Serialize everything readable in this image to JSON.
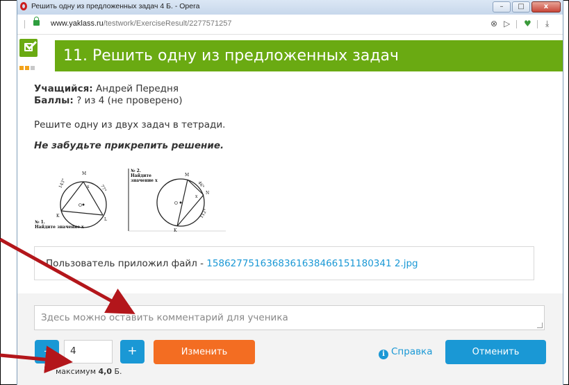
{
  "window": {
    "title": "Решить одну из предложенных задач 4 Б. - Opera",
    "minimize": "–",
    "maximize": "□",
    "close": "x"
  },
  "address": {
    "domain": "www.yaklass.ru",
    "path": "/testwork/ExerciseResult/2277571257"
  },
  "page": {
    "title": "11. Решить одну из предложенных задач",
    "student_label": "Учащийся:",
    "student_name": "Андрей Передня",
    "score_label": "Баллы:",
    "score_value": "? из 4 (не проверено)",
    "task_text": "Решите одну из двух задач в тетради.",
    "task_note": "Не забудьте прикрепить решение."
  },
  "figure": {
    "p1_head1": "№ 1.",
    "p1_head2": "Найдите значение x",
    "p1_m": "M",
    "p1_k": "K",
    "p1_l": "L",
    "p1_x": "x",
    "p1_o": "O",
    "p1_a1": "143°",
    "p1_a2": "77°",
    "p2_head1": "№ 2.",
    "p2_head2": "Найдите",
    "p2_head3": "значение x",
    "p2_m": "M",
    "p2_n": "N",
    "p2_k": "K",
    "p2_x": "x",
    "p2_o": "O",
    "p2_a1": "46°",
    "p2_a2": "112°"
  },
  "attachment": {
    "prefix": "Пользователь приложил файл - ",
    "filename": "1586277516368361638466151180341 2.jpg"
  },
  "grading": {
    "comment_placeholder": "Здесь можно оставить комментарий для ученика",
    "minus": "–",
    "plus": "+",
    "score": "4",
    "max_prefix": "максимум",
    "max_value": "4,0",
    "max_suffix": "Б.",
    "change_button": "Изменить",
    "help": "Справка",
    "help_icon": "i",
    "cancel_button": "Отменить"
  },
  "colors": {
    "brand_green": "#6aaa12",
    "primary_blue": "#1a98d5",
    "orange": "#f36d22",
    "arrow": "#b3161b"
  }
}
